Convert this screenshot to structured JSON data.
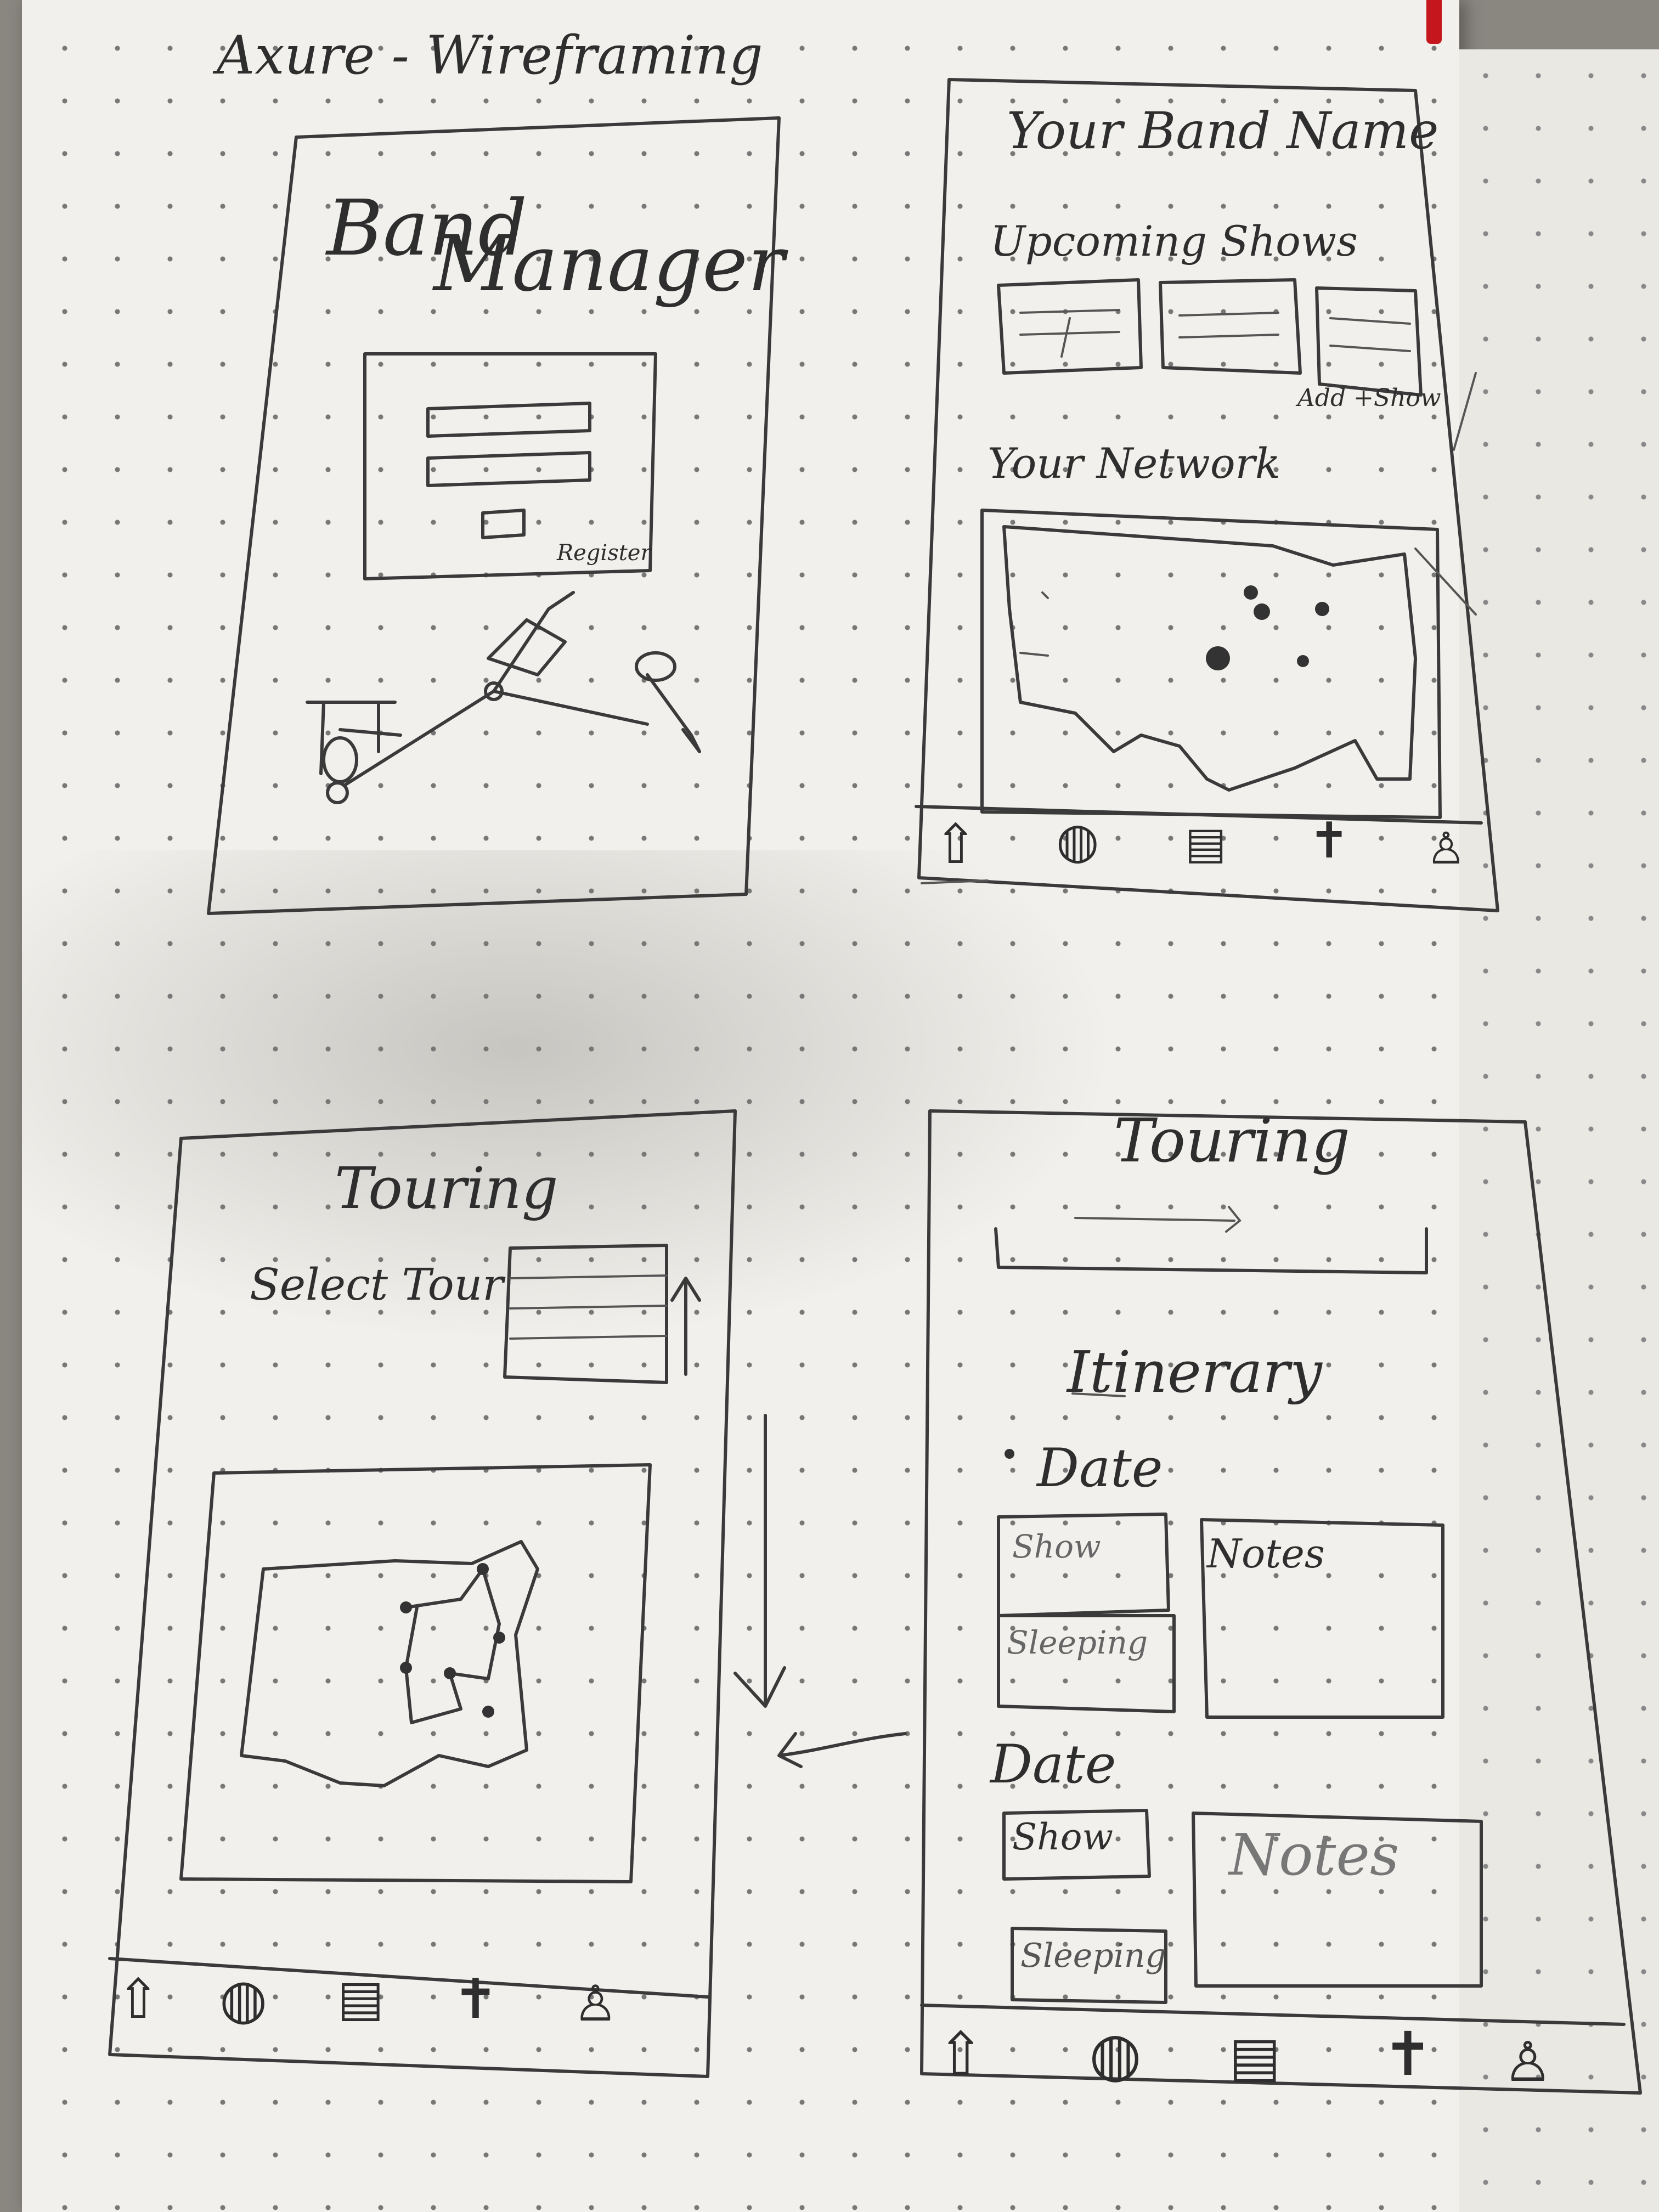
{
  "notebook": {
    "title": "Axure - Wireframing"
  },
  "screen_login": {
    "app_title_line1": "Band",
    "app_title_line2": "Manager",
    "register_label": "Register"
  },
  "screen_dashboard": {
    "band_name": "Your Band Name",
    "upcoming_shows_heading": "Upcoming Shows",
    "add_show_label": "Add +Show",
    "network_heading": "Your Network"
  },
  "screen_touring_select": {
    "title": "Touring",
    "select_tour_label": "Select Tour"
  },
  "screen_itinerary": {
    "title": "Touring",
    "itinerary_heading": "Itinerary",
    "days": [
      {
        "date_label": "Date",
        "show_label": "Show",
        "sleeping_label": "Sleeping",
        "notes_label": "Notes"
      },
      {
        "date_label": "Date",
        "show_label": "Show",
        "sleeping_label": "Sleeping",
        "notes_label": "Notes"
      }
    ]
  },
  "nav_icons": [
    "home-icon",
    "globe-icon",
    "calendar-icon",
    "guitar-icon",
    "profile-icon"
  ]
}
